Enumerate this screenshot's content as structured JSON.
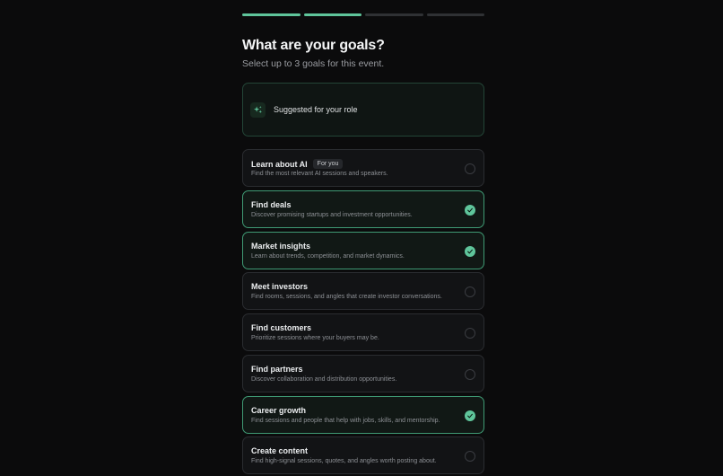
{
  "progress": {
    "total_steps": 4,
    "completed_steps": 2
  },
  "header": {
    "title": "What are your goals?",
    "subtitle": "Select up to 3 goals for this event."
  },
  "suggestion": {
    "label": "Suggested for your role",
    "icon": "sparkle-icon"
  },
  "goals": [
    {
      "title": "Learn about AI",
      "badge": "For you",
      "desc": "Find the most relevant AI sessions and speakers.",
      "selected": false
    },
    {
      "title": "Find deals",
      "desc": "Discover promising startups and investment opportunities.",
      "selected": true
    },
    {
      "title": "Market insights",
      "desc": "Learn about trends, competition, and market dynamics.",
      "selected": true
    },
    {
      "title": "Meet investors",
      "desc": "Find rooms, sessions, and angles that create investor conversations.",
      "selected": false
    },
    {
      "title": "Find customers",
      "desc": "Prioritize sessions where your buyers may be.",
      "selected": false
    },
    {
      "title": "Find partners",
      "desc": "Discover collaboration and distribution opportunities.",
      "selected": false
    },
    {
      "title": "Career growth",
      "desc": "Find sessions and people that help with jobs, skills, and mentorship.",
      "selected": true
    },
    {
      "title": "Create content",
      "desc": "Find high-signal sessions, quotes, and angles worth posting about.",
      "selected": false
    }
  ],
  "colors": {
    "accent": "#5fc59b",
    "background": "#0b0b0c",
    "card": "#121315"
  }
}
